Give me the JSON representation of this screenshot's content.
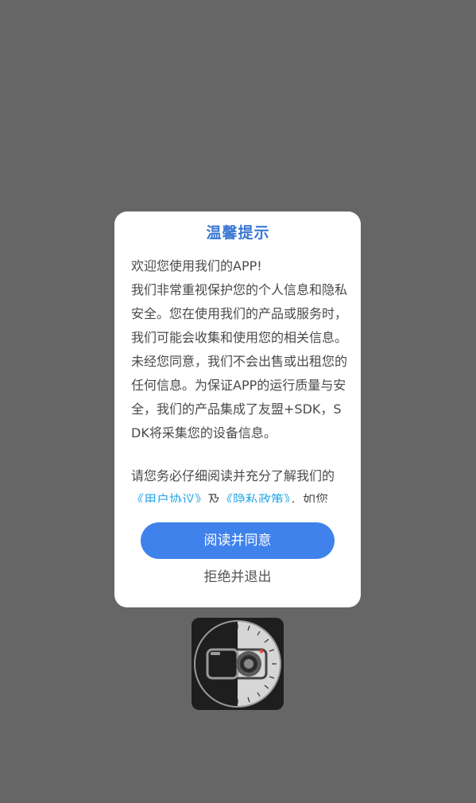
{
  "overlay": {
    "background": "#666666"
  },
  "app_icon": {
    "icon": "camera-dial-icon"
  },
  "dialog": {
    "title": "温馨提示",
    "title_color": "#3a78d4",
    "content": {
      "greeting": "欢迎您使用我们的APP!",
      "paragraph1": "我们非常重视保护您的个人信息和隐私安全。您在使用我们的产品或服务时，我们可能会收集和使用您的相关信息。未经您同意，我们不会出售或出租您的任何信息。为保证APP的运行质量与安全，我们的产品集成了友盟+SDK，SDK将采集您的设备信息。",
      "paragraph2_prefix": "请您务必仔细阅读并充分了解我们的",
      "user_agreement_link": "《用户协议》",
      "and_text": "及",
      "privacy_policy_link": "《隐私政策》",
      "paragraph2_suffix": "，如您"
    },
    "agree_button_label": "阅读并同意",
    "agree_button_color": "#3f82ec",
    "refuse_button_label": "拒绝并退出",
    "link_color": "#2aa6e8"
  }
}
